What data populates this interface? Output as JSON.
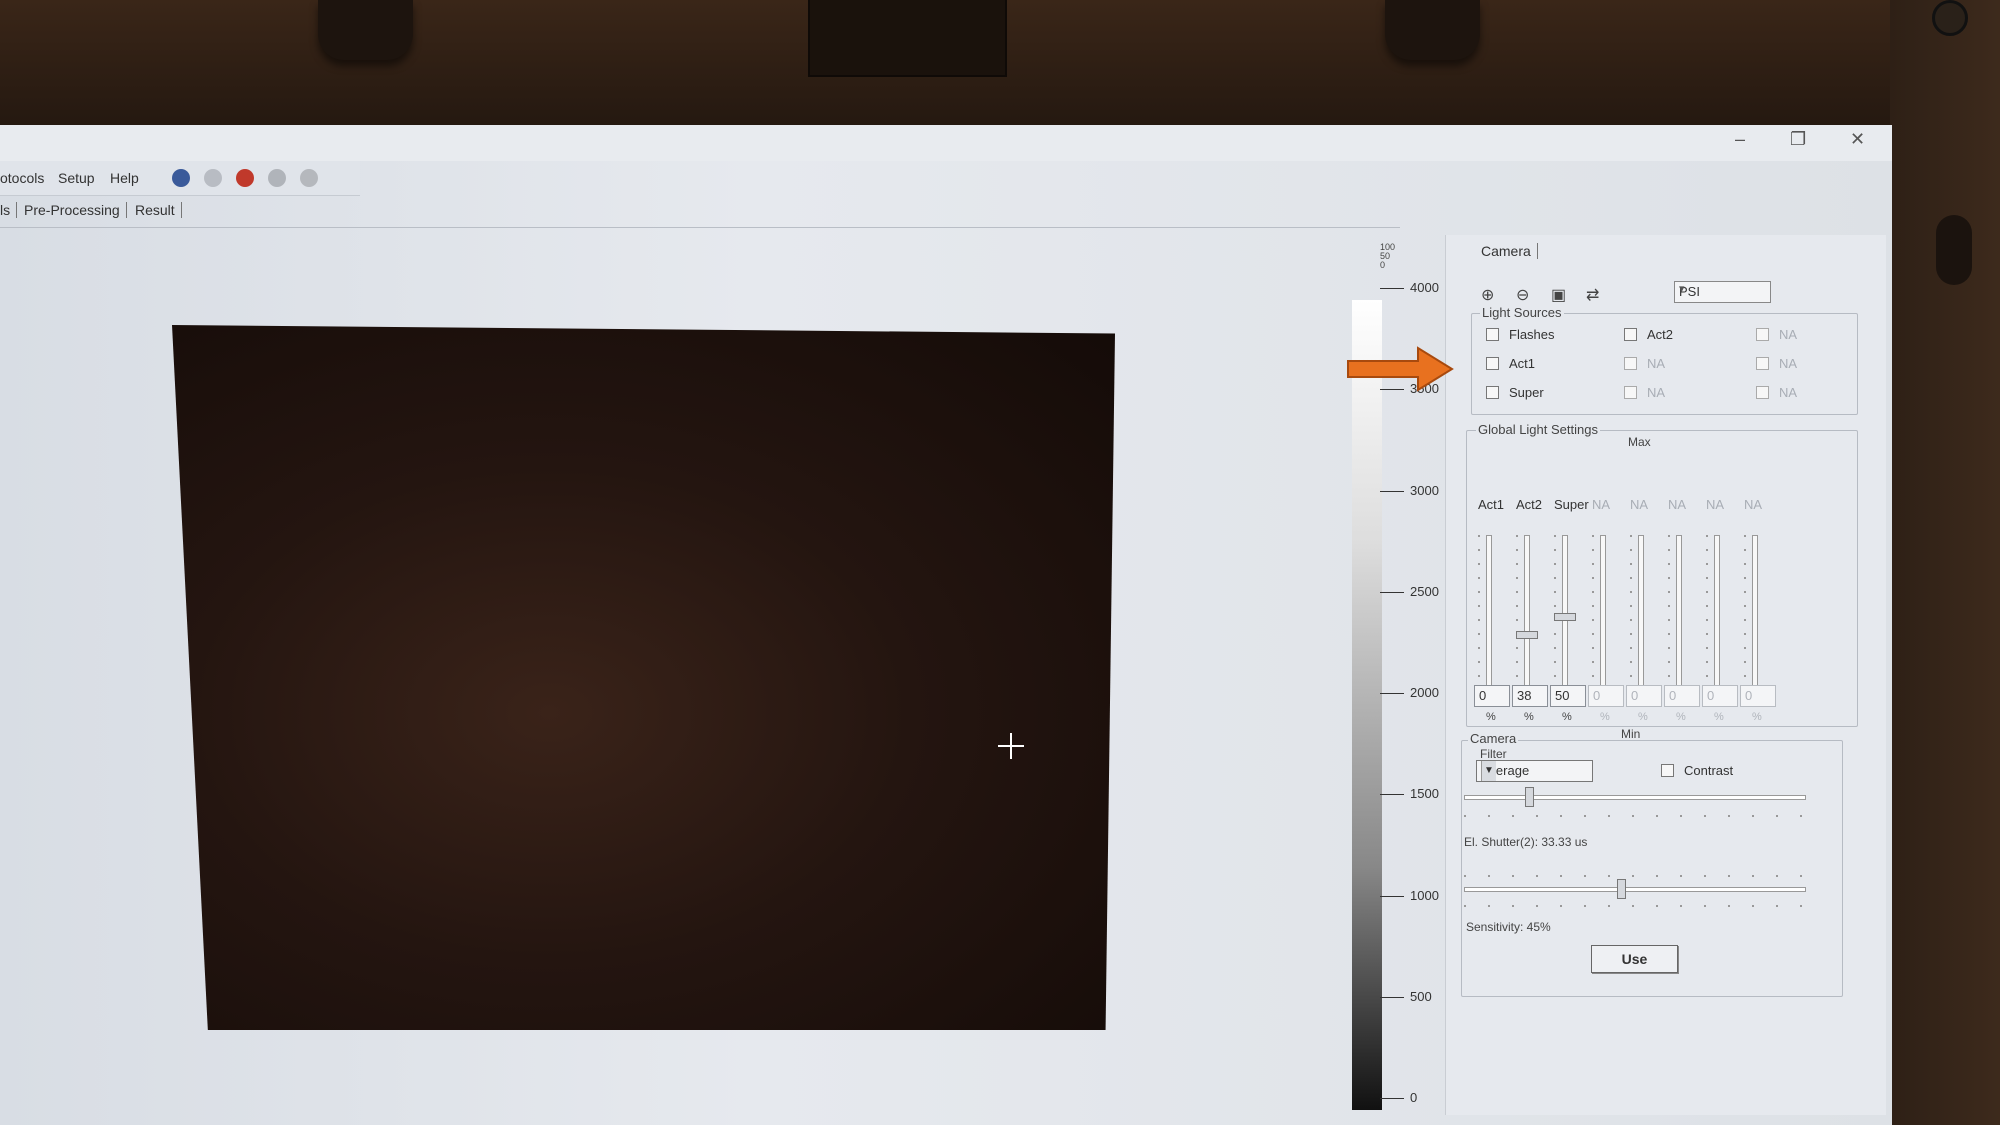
{
  "menu": {
    "items": [
      "otocols",
      "Setup",
      "Help"
    ]
  },
  "tabs": [
    "ls",
    "Pre-Processing",
    "Result"
  ],
  "window_controls": {
    "minimize": "–",
    "restore": "❐",
    "close": "✕"
  },
  "scale": {
    "top_labels": [
      "100",
      "50",
      "0"
    ],
    "ticks": [
      {
        "label": "4000",
        "value": 4000
      },
      {
        "label": "3500",
        "value": 3500
      },
      {
        "label": "3000",
        "value": 3000
      },
      {
        "label": "2500",
        "value": 2500
      },
      {
        "label": "2000",
        "value": 2000
      },
      {
        "label": "1500",
        "value": 1500
      },
      {
        "label": "1000",
        "value": 1000
      },
      {
        "label": "500",
        "value": 500
      },
      {
        "label": "0",
        "value": 0
      }
    ]
  },
  "panel": {
    "tab": "Camera",
    "protocol_select": "PSI",
    "light_sources": {
      "title": "Light Sources",
      "col1": [
        "Flashes",
        "Act1",
        "Super"
      ],
      "col2": [
        "Act2",
        "NA",
        "NA"
      ],
      "col3": [
        "NA",
        "NA",
        "NA"
      ]
    },
    "global_light": {
      "title": "Global Light Settings",
      "max_label": "Max",
      "min_label": "Min",
      "channels": [
        {
          "label": "Act1",
          "value": "0",
          "unit": "%",
          "level": 0
        },
        {
          "label": "Act2",
          "value": "38",
          "unit": "%",
          "level": 0.38
        },
        {
          "label": "Super",
          "value": "50",
          "unit": "%",
          "level": 0.5
        },
        {
          "label": "NA",
          "value": "0",
          "unit": "%",
          "level": 0
        },
        {
          "label": "NA",
          "value": "0",
          "unit": "%",
          "level": 0
        },
        {
          "label": "NA",
          "value": "0",
          "unit": "%",
          "level": 0
        },
        {
          "label": "NA",
          "value": "0",
          "unit": "%",
          "level": 0
        },
        {
          "label": "NA",
          "value": "0",
          "unit": "%",
          "level": 0
        }
      ]
    },
    "camera": {
      "title": "Camera",
      "filter_label": "Filter",
      "filter_value": "Average",
      "contrast_label": "Contrast",
      "shutter_text": "El. Shutter(2): 33.33 us",
      "shutter_level": 0.18,
      "sensitivity_text": "Sensitivity: 45%",
      "sensitivity_level": 0.45,
      "use_button": "Use"
    }
  }
}
